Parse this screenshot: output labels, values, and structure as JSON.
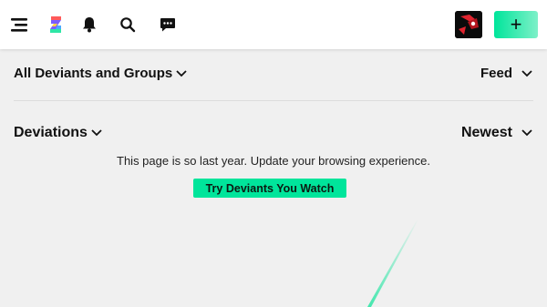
{
  "colors": {
    "accent": "#00e59b",
    "accent_gradient_end": "#7ef0c8",
    "background": "#f0f0f0",
    "topbar": "#ffffff"
  },
  "topbar": {
    "icons": [
      "menu-icon",
      "deviantart-logo-icon",
      "bell-icon",
      "search-icon",
      "chat-icon"
    ],
    "create_label": "+"
  },
  "filters": {
    "source_label": "All Deviants and Groups",
    "view_label": "Feed"
  },
  "deviations": {
    "type_label": "Deviations",
    "sort_label": "Newest"
  },
  "notice": {
    "text": "This page is so last year. Update your browsing experience.",
    "button_label": "Try Deviants You Watch"
  }
}
